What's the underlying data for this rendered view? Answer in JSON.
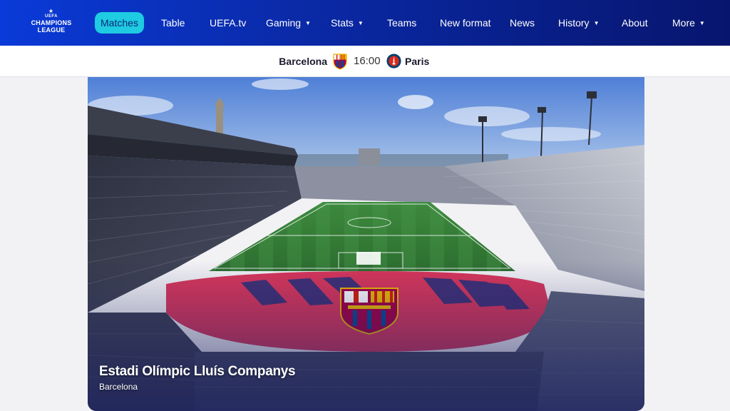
{
  "brand": {
    "uefa": "UEFA",
    "line1": "CHAMPIONS",
    "line2": "LEAGUE"
  },
  "nav": {
    "matches": "Matches",
    "table": "Table",
    "uefatv": "UEFA.tv",
    "gaming": "Gaming",
    "stats": "Stats",
    "teams": "Teams",
    "new_format": "New format",
    "news": "News",
    "history": "History",
    "about": "About",
    "more": "More"
  },
  "match": {
    "home": "Barcelona",
    "away": "Paris",
    "kickoff": "16:00"
  },
  "venue": {
    "name": "Estadi Olímpic Lluís Companys",
    "city": "Barcelona"
  },
  "colors": {
    "nav_start": "#0a3ad8",
    "nav_end": "#07156e",
    "active_pill": "#1ecbe1"
  }
}
